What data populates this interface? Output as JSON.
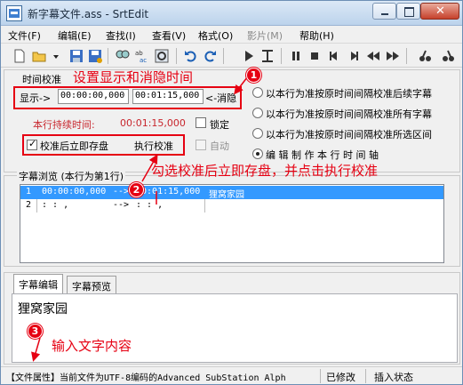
{
  "window": {
    "title": "新字幕文件.ass - SrtEdit"
  },
  "menu": [
    "文件(F)",
    "编辑(E)",
    "查找(I)",
    "查看(V)",
    "格式(O)",
    "影片(M)",
    "帮助(H)"
  ],
  "toolbar": {
    "icons": [
      "new-file-icon",
      "open-folder-icon",
      "save-icon",
      "save-as-icon",
      "find-icon",
      "spell-check-icon",
      "preview-icon",
      "undo-icon",
      "redo-icon",
      "play-icon",
      "mark-icon",
      "pause-icon",
      "stop-icon",
      "prev-icon",
      "next-icon",
      "rewind-icon",
      "fast-forward-icon",
      "slow-icon",
      "fast-icon"
    ]
  },
  "timing": {
    "group_title": "时间校准",
    "show_label": "显示->",
    "start_time": "00:00:00,000",
    "end_time": "00:01:15,000",
    "hide_label": "<-消隐",
    "duration_label": "本行持续时间:",
    "duration_value": "00:01:15,000",
    "lock_label": "锁定",
    "calibrate_after_save_label": "校准后立即存盘",
    "calibrate_after_save_checked": true,
    "execute_label": "执行校准",
    "auto_label": "自动",
    "radio_options": [
      "以本行为准按原时间间隔校准后续字幕",
      "以本行为准按原时间间隔校准所有字幕",
      "以本行为准按原时间间隔校准所选区间",
      "编 辑 制 作 本 行 时 间 轴"
    ],
    "radio_selected": 3
  },
  "subtitle_list": {
    "title": "字幕浏览 (本行为第1行)",
    "rows": [
      {
        "num": "1",
        "start": "00:00:00,000",
        "arrow": "-->",
        "end": "00:01:15,000",
        "text": "狸窝家园"
      },
      {
        "num": "2",
        "start": "  :  :  ,",
        "arrow": "-->",
        "end": "  :  :  ,",
        "text": ""
      }
    ]
  },
  "editor": {
    "tabs": [
      "字幕编辑",
      "字幕预览"
    ],
    "content": "狸窝家园"
  },
  "status": {
    "file_info": "【文件属性】当前文件为UTF-8编码的Advanced SubStation Alph",
    "modified": "已修改",
    "mode": "插入状态"
  },
  "annotations": {
    "a1": "设置显示和消隐时间",
    "a2": "勾选校准后立即存盘，并点击执行校准",
    "a3": "输入文字内容",
    "n1": "1",
    "n2": "2",
    "n3": "3"
  },
  "colors": {
    "annotation_red": "#e60012",
    "selection_blue": "#3399ff",
    "duration_red": "#c8262d"
  }
}
